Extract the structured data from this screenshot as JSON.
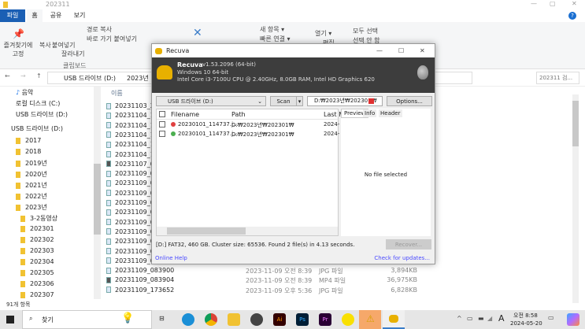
{
  "explorer": {
    "title": "202311",
    "tabs": [
      "파일",
      "홈",
      "공유",
      "보기"
    ],
    "ribbon": {
      "pin": "즐겨찾기에 고정",
      "copy": "복사",
      "paste": "붙여넣기",
      "copy_path": "경로 복사",
      "paste_shortcut": "바로 가기 붙여넣기",
      "cut": "잘라내기",
      "clipboard_group": "클립보드",
      "new_item": "새 항목 ▾",
      "easy_access": "빠른 연결 ▾",
      "open": "열기 ▾",
      "edit": "편집",
      "select_all": "모두 선택",
      "select_none": "선택 안 함"
    },
    "breadcrumb": [
      "USB 드라이브 (D:)",
      "2023년"
    ],
    "search_placeholder": "202311 검...",
    "nav": {
      "music": "음악",
      "local_disk": "로컬 디스크 (C:)",
      "usb1": "USB 드라이브 (D:)",
      "usb2": "USB 드라이브 (D:)",
      "folders": [
        "2017",
        "2018",
        "2019년",
        "2020년",
        "2021년",
        "2022년",
        "2023년"
      ],
      "subfolders": [
        "3-2동영상",
        "202301",
        "202302",
        "202303",
        "202304",
        "202305",
        "202306",
        "202307"
      ]
    },
    "column_name": "이름",
    "files": [
      {
        "name": "20231103_2"
      },
      {
        "name": "20231104_14"
      },
      {
        "name": "20231104_14"
      },
      {
        "name": "20231104_14"
      },
      {
        "name": "20231104_14"
      },
      {
        "name": "20231104_14"
      },
      {
        "name": "20231107_07",
        "video": true
      },
      {
        "name": "20231109_08"
      },
      {
        "name": "20231109_08"
      },
      {
        "name": "20231109_08"
      },
      {
        "name": "20231109_08"
      },
      {
        "name": "20231109_08"
      },
      {
        "name": "20231109_08"
      },
      {
        "name": "20231109_08"
      },
      {
        "name": "20231109_08"
      },
      {
        "name": "20231109_0"
      },
      {
        "name": "20231109_08"
      },
      {
        "name": "20231109_083900",
        "date": "2023-11-09 오전 8:39",
        "type": "JPG 파일",
        "size": "3,894KB"
      },
      {
        "name": "20231109_083904",
        "date": "2023-11-09 오전 8:39",
        "type": "MP4 파일",
        "size": "36,975KB",
        "video": true
      },
      {
        "name": "20231109_173652",
        "date": "2023-11-09 오후 5:36",
        "type": "JPG 파일",
        "size": "6,828KB"
      }
    ],
    "status": "91개 항목"
  },
  "recuva": {
    "window_title": "Recuva",
    "app_name": "Recuva",
    "version": "v1.53.2096 (64-bit)",
    "os": "Windows 10 64-bit",
    "hardware": "Intel Core i3-7100U CPU @ 2.40GHz, 8.0GB RAM, Intel HD Graphics 620",
    "drive": "USB 드라이브 (D:)",
    "scan": "Scan",
    "path_filter": "D:₩2023년₩202301₩",
    "options": "Options...",
    "columns": [
      "Filename",
      "Path",
      "Last M"
    ],
    "results": [
      {
        "filename": "20230101_114737.j...",
        "path": "D:₩2023년₩202301₩",
        "last": "2024-",
        "state": "#e04040"
      },
      {
        "filename": "20230101_114737.j...",
        "path": "D:₩2023년₩202301₩",
        "last": "2024-",
        "state": "#4caf50"
      }
    ],
    "preview_tabs": [
      "Preview",
      "Info",
      "Header"
    ],
    "no_file": "No file selected",
    "status": "[D:] FAT32, 460 GB. Cluster size: 65536. Found 2 file(s) in 4.13 seconds.",
    "recover": "Recover...",
    "online_help": "Online Help",
    "check_updates": "Check for updates..."
  },
  "taskbar": {
    "search": "찾기",
    "ime": "A",
    "time": "오전 8:58",
    "date": "2024-05-20"
  }
}
